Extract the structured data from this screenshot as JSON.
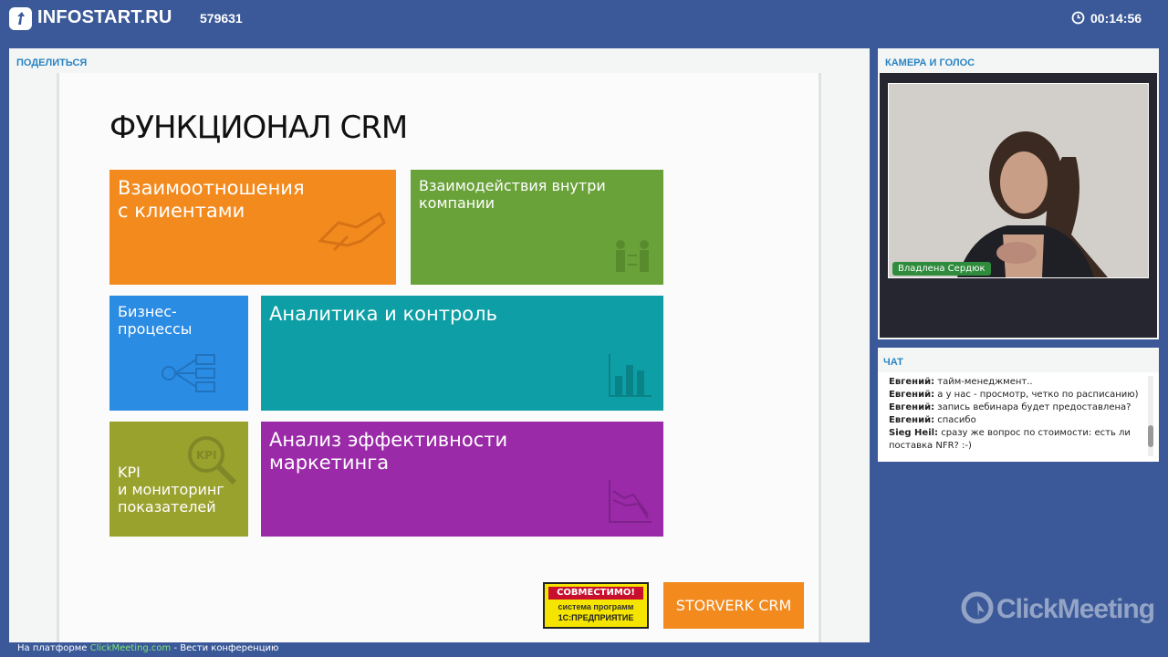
{
  "header": {
    "logo_text": "INFOSTART.RU",
    "room_id": "579631",
    "timer": "00:14:56"
  },
  "share": {
    "title": "ПОДЕЛИТЬСЯ",
    "slide": {
      "title": "ФУНКЦИОНАЛ CRM",
      "tiles": [
        {
          "text": "Взаимоотношения\nс клиентами",
          "color": "#f38a1e",
          "icon": "handshake-icon"
        },
        {
          "text": "Взаимодействия внутри\nкомпании",
          "color": "#6aa23a",
          "icon": "people-icon"
        },
        {
          "text": "Бизнес-\nпроцессы",
          "color": "#2b8ce4",
          "icon": "process-flow-icon"
        },
        {
          "text": "Аналитика и контроль",
          "color": "#0d9fa5",
          "icon": "bar-chart-icon"
        },
        {
          "text": "KPI\nи мониторинг\nпоказателей",
          "color": "#9aa22e",
          "icon": "kpi-magnifier-icon"
        },
        {
          "text": "Анализ  эффективности\nмаркетинга",
          "color": "#9a2aa8",
          "icon": "line-chart-icon"
        }
      ],
      "logo_1c": {
        "top": "СОВМЕСТИМО!",
        "line2": "система программ",
        "line3": "1С:ПРЕДПРИЯТИЕ"
      },
      "storverk": "STORVERK CRM"
    }
  },
  "camera": {
    "title": "КАМЕРА И ГОЛОС",
    "presenter_name": "Владлена Сердюк"
  },
  "chat": {
    "title": "ЧАТ",
    "messages": [
      {
        "author": "Евгений:",
        "text": " тайм-менеджмент.."
      },
      {
        "author": "Евгений:",
        "text": " а у нас - просмотр, четко по расписанию)"
      },
      {
        "author": "Евгений:",
        "text": " запись вебинара будет предоставлена?"
      },
      {
        "author": "Евгений:",
        "text": " спасибо"
      },
      {
        "author": "Sieg Heil:",
        "text": " сразу же вопрос по стоимости: есть ли"
      },
      {
        "author": "",
        "text": "поставка NFR? :-)"
      }
    ]
  },
  "footer": {
    "prefix": "На платформе ",
    "link": "ClickMeeting.com",
    "suffix": " - Вести конференцию"
  },
  "watermark": "ClickMeeting"
}
